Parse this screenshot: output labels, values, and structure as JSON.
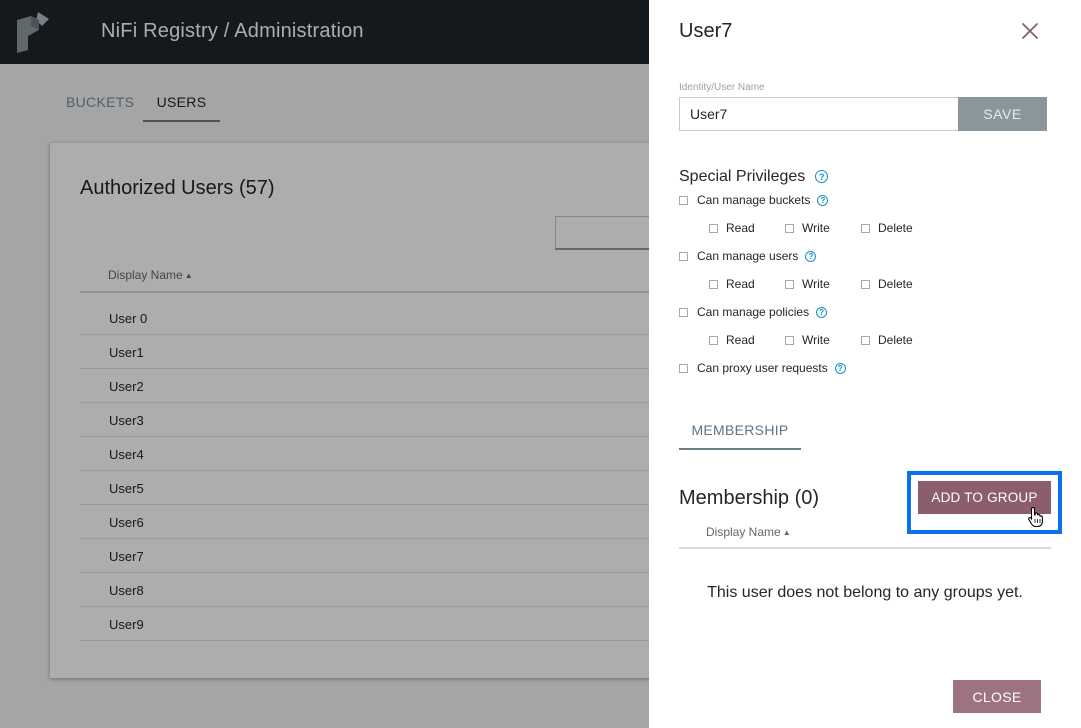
{
  "app": {
    "title": "NiFi Registry / Administration",
    "tabs": [
      {
        "label": "BUCKETS",
        "active": false
      },
      {
        "label": "USERS",
        "active": true
      }
    ]
  },
  "users_list": {
    "title": "Authorized Users (57)",
    "column_header": "Display Name",
    "sort_icon": "sort-ascending-icon",
    "rows": [
      "User 0",
      "User1",
      "User2",
      "User3",
      "User4",
      "User5",
      "User6",
      "User7",
      "User8",
      "User9"
    ]
  },
  "panel": {
    "title": "User7",
    "close_icon": "close-icon",
    "identity": {
      "label": "Identity/User Name",
      "value": "User7",
      "save_label": "SAVE"
    },
    "special_privileges": {
      "title": "Special Privileges",
      "help_icon": "help-icon",
      "groups": [
        {
          "label": "Can manage buckets",
          "subs": [
            "Read",
            "Write",
            "Delete"
          ]
        },
        {
          "label": "Can manage users",
          "subs": [
            "Read",
            "Write",
            "Delete"
          ]
        },
        {
          "label": "Can manage policies",
          "subs": [
            "Read",
            "Write",
            "Delete"
          ]
        },
        {
          "label": "Can proxy user requests",
          "subs": []
        }
      ]
    },
    "membership": {
      "tab_label": "MEMBERSHIP",
      "title": "Membership (0)",
      "add_label": "ADD TO GROUP",
      "column_header": "Display Name",
      "empty_message": "This user does not belong to any groups yet."
    },
    "close_label": "CLOSE"
  },
  "colors": {
    "topbar": "#1d262a",
    "accent_button": "#8b5d6e",
    "save_button": "#8a959c",
    "help_blue": "#1491c1",
    "highlight": "#0a72e8"
  }
}
